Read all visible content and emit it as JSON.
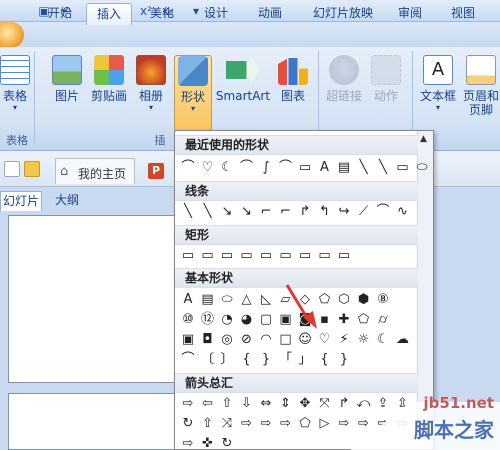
{
  "tabs": [
    "开始",
    "插入",
    "美化",
    "设计",
    "动画",
    "幻灯片放映",
    "审阅",
    "视图"
  ],
  "active_tab": "插入",
  "ribbon": {
    "table": "表格",
    "picture": "图片",
    "clipart": "剪贴画",
    "album": "相册",
    "shapes": "形状",
    "smartart": "SmartArt",
    "chart": "图表",
    "hyperlink": "超链接",
    "action": "动作",
    "textbox": "文本框",
    "header_footer": "页眉和\n页脚",
    "group_table": "表格",
    "group_illustrations": "插"
  },
  "nav": {
    "home_tab": "我的主页"
  },
  "panel_tabs": {
    "slides": "幻灯片",
    "outline": "大纲"
  },
  "gallery": {
    "sections": [
      {
        "title": "最近使用的形状",
        "rows": [
          [
            "⌒",
            "♡",
            "☾",
            "⌒",
            "∫",
            "⌒",
            "▭",
            "A",
            "▤",
            "╲",
            "╲",
            "▭",
            "⬭"
          ]
        ]
      },
      {
        "title": "线条",
        "rows": [
          [
            "╲",
            "╲",
            "↘",
            "↘",
            "⌐",
            "⌐",
            "↱",
            "↰",
            "↪",
            "⟋",
            "⌒",
            "∿"
          ]
        ]
      },
      {
        "title": "矩形",
        "rows": [
          [
            "▭",
            "▭",
            "▭",
            "▭",
            "▭",
            "▭",
            "▭",
            "▭",
            "▭"
          ]
        ]
      },
      {
        "title": "基本形状",
        "rows": [
          [
            "A",
            "▤",
            "⬭",
            "△",
            "◺",
            "▱",
            "◇",
            "⬠",
            "⬡",
            "⬢",
            "⑧"
          ],
          [
            "⑩",
            "⑫",
            "◔",
            "◕",
            "▢",
            "▣",
            "◙",
            "▪",
            "✚",
            "⬠",
            "⌭"
          ],
          [
            "▣",
            "◘",
            "◎",
            "⊘",
            "◠",
            "□",
            "☺",
            "♡",
            "⚡",
            "☼",
            "☾",
            "☁"
          ],
          [
            "⌒",
            "〔",
            "〕",
            "{",
            "}",
            "「",
            "」",
            "{",
            "}"
          ]
        ]
      },
      {
        "title": "箭头总汇",
        "rows": [
          [
            "⇨",
            "⇦",
            "⇧",
            "⇩",
            "⇔",
            "⇕",
            "✥",
            "⤧",
            "↱",
            "⤺",
            "⇪",
            "⇫"
          ],
          [
            "↻",
            "⇧",
            "⤨",
            "⇨",
            "⇨",
            "⇨",
            "⬠",
            "▷",
            "⇨",
            "⇨",
            "⇨",
            "⇨"
          ],
          [
            "⇨",
            "✜",
            "↻"
          ]
        ]
      }
    ]
  },
  "watermark": {
    "url": "jb51.net",
    "name": "脚本之家"
  },
  "colors": {
    "ribbon_text": "#15428b",
    "pressed": "#f9c45e",
    "annotation_arrow": "#e03a2e"
  }
}
